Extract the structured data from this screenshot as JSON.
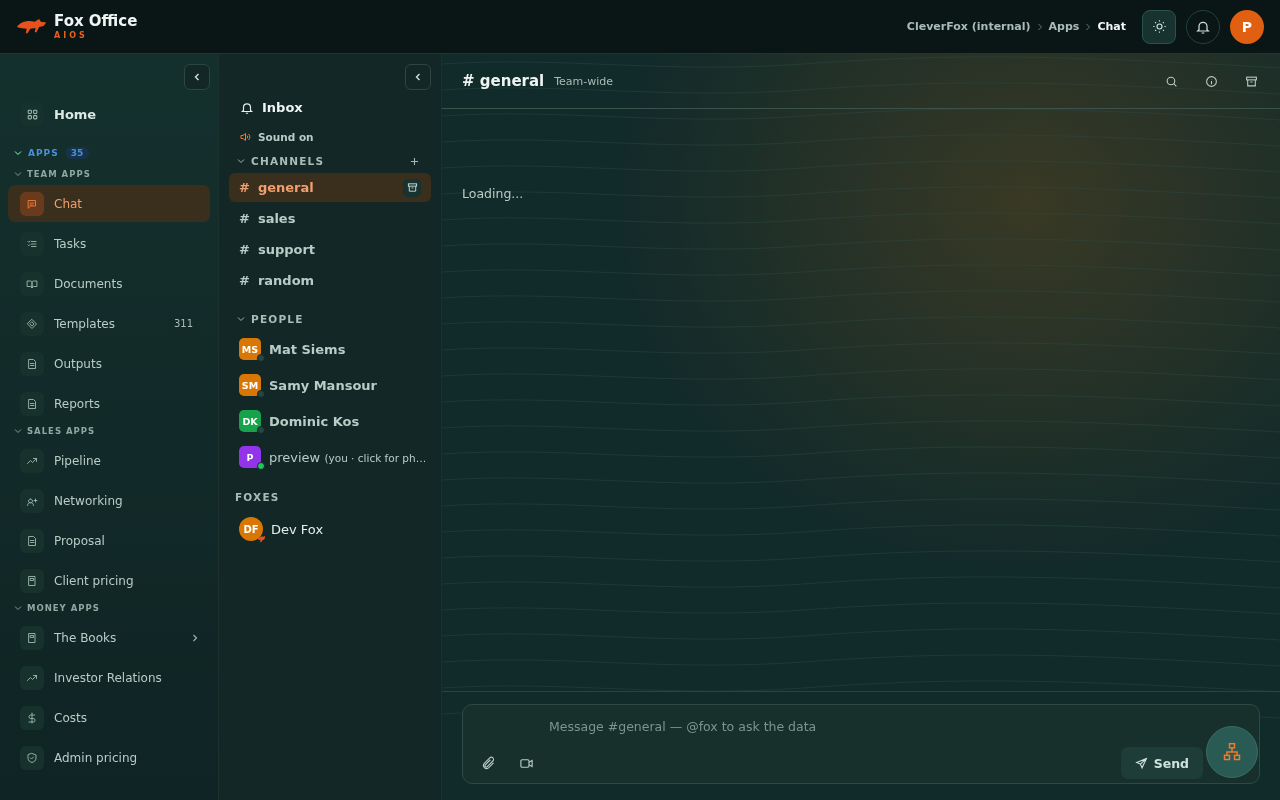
{
  "brand": {
    "name": "Fox Office",
    "tagline": "AIOS"
  },
  "breadcrumb": [
    {
      "label": "CleverFox (internal)",
      "current": false
    },
    {
      "label": "Apps",
      "current": false
    },
    {
      "label": "Chat",
      "current": true
    }
  ],
  "header_actions": {
    "avatar": "P",
    "theme_toggle_on": true
  },
  "sidebar": {
    "home": "Home",
    "apps_label": "APPS",
    "apps_count": "35",
    "sections": [
      {
        "title": "TEAM APPS",
        "items": [
          {
            "label": "Chat",
            "selected": true
          },
          {
            "label": "Tasks",
            "selected": false
          },
          {
            "label": "Documents",
            "selected": false
          },
          {
            "label": "Templates",
            "selected": false,
            "count": "311"
          },
          {
            "label": "Outputs",
            "selected": false
          },
          {
            "label": "Reports",
            "selected": false
          }
        ]
      },
      {
        "title": "SALES APPS",
        "items": [
          {
            "label": "Pipeline",
            "selected": false
          },
          {
            "label": "Networking",
            "selected": false
          },
          {
            "label": "Proposal",
            "selected": false
          },
          {
            "label": "Client pricing",
            "selected": false
          }
        ]
      },
      {
        "title": "MONEY APPS",
        "items": [
          {
            "label": "The Books",
            "selected": false,
            "has_submenu": true
          },
          {
            "label": "Investor Relations",
            "selected": false
          },
          {
            "label": "Costs",
            "selected": false
          },
          {
            "label": "Admin pricing",
            "selected": false
          }
        ]
      }
    ]
  },
  "chat_nav": {
    "inbox": "Inbox",
    "sound": "Sound on",
    "sound_on": true,
    "channels_title": "CHANNELS",
    "channels": [
      {
        "hash": "#",
        "name": "general",
        "selected": true
      },
      {
        "hash": "#",
        "name": "sales",
        "selected": false
      },
      {
        "hash": "#",
        "name": "support",
        "selected": false
      },
      {
        "hash": "#",
        "name": "random",
        "selected": false
      }
    ],
    "people_title": "PEOPLE",
    "people": [
      {
        "initials": "MS",
        "name": "Mat Siems",
        "color": "#d97706",
        "online": false
      },
      {
        "initials": "SM",
        "name": "Samy Mansour",
        "color": "#d97706",
        "online": false
      },
      {
        "initials": "DK",
        "name": "Dominic Kos",
        "color": "#16a34a",
        "online": false
      },
      {
        "initials": "P",
        "name": "preview",
        "note": "(you · click for ph…",
        "color": "#9333ea",
        "online": true
      }
    ],
    "foxes_title": "FOXES",
    "foxes": [
      {
        "initials": "DF",
        "name": "Dev Fox",
        "color": "#d97706"
      }
    ]
  },
  "channel_header": {
    "hash": "#",
    "name": "general",
    "scope": "Team-wide"
  },
  "messages_status": "Loading...",
  "composer": {
    "placeholder": "Message #general — @fox to ask the data",
    "send": "Send"
  }
}
